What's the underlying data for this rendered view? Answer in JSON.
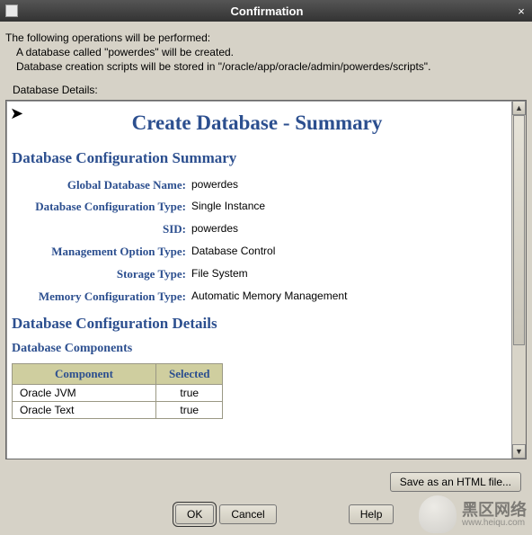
{
  "window": {
    "title": "Confirmation",
    "close": "×"
  },
  "preamble": {
    "line1": "The following operations will be performed:",
    "line2": "A database called \"powerdes\" will be created.",
    "line3": "Database creation scripts will be stored in \"/oracle/app/oracle/admin/powerdes/scripts\"."
  },
  "details_label": "Database Details:",
  "document": {
    "title": "Create Database - Summary",
    "section1": "Database Configuration Summary",
    "summary": {
      "rows": [
        {
          "label": "Global Database Name:",
          "value": "powerdes"
        },
        {
          "label": "Database Configuration Type:",
          "value": "Single Instance"
        },
        {
          "label": "SID:",
          "value": "powerdes"
        },
        {
          "label": "Management Option Type:",
          "value": "Database Control"
        },
        {
          "label": "Storage Type:",
          "value": "File System"
        },
        {
          "label": "Memory Configuration Type:",
          "value": "Automatic Memory Management"
        }
      ]
    },
    "section2": "Database Configuration Details",
    "subsection": "Database Components",
    "components": {
      "headers": {
        "component": "Component",
        "selected": "Selected"
      },
      "rows": [
        {
          "component": "Oracle JVM",
          "selected": "true"
        },
        {
          "component": "Oracle Text",
          "selected": "true"
        }
      ]
    }
  },
  "buttons": {
    "save": "Save as an HTML file...",
    "ok": "OK",
    "cancel": "Cancel",
    "help": "Help"
  },
  "watermark": {
    "text": "黑区网络",
    "url": "www.heiqu.com"
  }
}
